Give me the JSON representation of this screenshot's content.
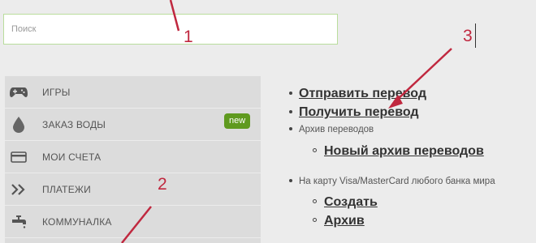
{
  "search": {
    "placeholder": "Поиск"
  },
  "sidebar": {
    "items": [
      {
        "label": "ИГРЫ",
        "icon": "gamepad-icon"
      },
      {
        "label": "ЗАКАЗ ВОДЫ",
        "icon": "water-drop-icon",
        "badge": "new"
      },
      {
        "label": "МОИ СЧЕТА",
        "icon": "credit-card-icon"
      },
      {
        "label": "ПЛАТЕЖИ",
        "icon": "double-chevron-icon"
      },
      {
        "label": "КОММУНАЛКА",
        "icon": "faucet-icon"
      }
    ]
  },
  "transfers": {
    "send": "Отправить перевод",
    "receive": "Получить перевод",
    "archive_label": "Архив переводов",
    "new_archive": "Новый архив переводов",
    "card_text": "На карту Visa/MasterCard любого банка мира",
    "create": "Создать",
    "archive": "Архив"
  },
  "annotations": {
    "n1": "1",
    "n2": "2",
    "n3": "3"
  },
  "colors": {
    "annotation": "#c0283f",
    "badge": "#5f9a1f",
    "search_border": "#b9dd9c"
  }
}
